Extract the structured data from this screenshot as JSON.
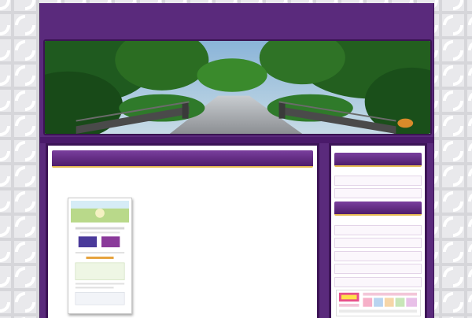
{
  "site": {
    "title": "",
    "description": ""
  },
  "post": {
    "title": "",
    "intro": "",
    "lines": [
      "",
      "",
      "",
      "",
      "",
      "",
      "",
      "",
      "",
      "",
      "",
      "",
      "",
      "",
      ""
    ],
    "link_text": ""
  },
  "sidebar": {
    "widgets": [
      {
        "title": "",
        "items": [
          "",
          ""
        ]
      },
      {
        "title": "",
        "items": [
          "",
          "",
          "",
          "",
          ""
        ]
      }
    ]
  },
  "icons": {
    "hero": "park-bridge-photo",
    "thumbnail": "website-screenshot-thumbnail",
    "banner": "advertisement-banner"
  },
  "colors": {
    "frame": "#5a2a7c",
    "title_gold": "#f2d68a",
    "accent_gold": "#e4b950",
    "link_red": "#c8102e"
  }
}
